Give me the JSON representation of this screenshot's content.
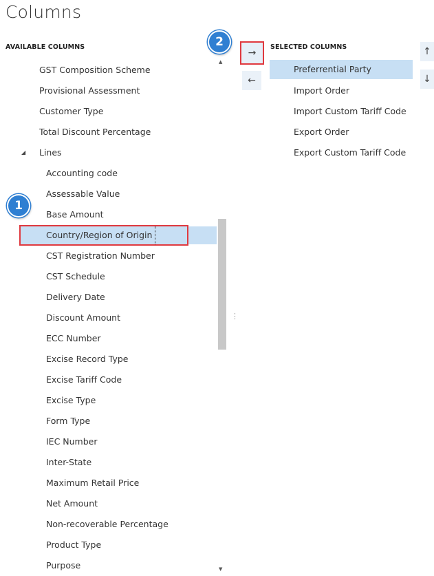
{
  "page": {
    "title": "Columns"
  },
  "available": {
    "header": "AVAILABLE COLUMNS",
    "items": [
      {
        "label": "GST Composition Scheme"
      },
      {
        "label": "Provisional Assessment"
      },
      {
        "label": "Customer Type"
      },
      {
        "label": "Total Discount Percentage"
      },
      {
        "label": "Lines",
        "group": true,
        "expanded": true
      },
      {
        "label": "Accounting code"
      },
      {
        "label": "Assessable Value"
      },
      {
        "label": "Base Amount"
      },
      {
        "label": "Country/Region of Origin",
        "selected": true
      },
      {
        "label": "CST Registration Number"
      },
      {
        "label": "CST Schedule"
      },
      {
        "label": "Delivery Date"
      },
      {
        "label": "Discount Amount"
      },
      {
        "label": "ECC Number"
      },
      {
        "label": "Excise Record Type"
      },
      {
        "label": "Excise Tariff Code"
      },
      {
        "label": "Excise Type"
      },
      {
        "label": "Form Type"
      },
      {
        "label": "IEC Number"
      },
      {
        "label": "Inter-State"
      },
      {
        "label": "Maximum Retail Price"
      },
      {
        "label": "Net Amount"
      },
      {
        "label": "Non-recoverable Percentage"
      },
      {
        "label": "Product Type"
      },
      {
        "label": "Purpose"
      }
    ]
  },
  "selected": {
    "header": "SELECTED COLUMNS",
    "items": [
      {
        "label": "Preferrential Party",
        "selected": true
      },
      {
        "label": "Import Order"
      },
      {
        "label": "Import Custom Tariff Code"
      },
      {
        "label": "Export Order"
      },
      {
        "label": "Export Custom Tariff Code"
      }
    ]
  },
  "buttons": {
    "add": "→",
    "remove": "←",
    "move_up": "↑",
    "move_down": "↓"
  },
  "badges": {
    "one": "1",
    "two": "2"
  },
  "glyphs": {
    "scroll_up": "▲",
    "scroll_down": "▼",
    "group_expander": "◢",
    "splitter": "⋮"
  },
  "colors": {
    "selection": "#c7dff4",
    "callout_box": "#e0393f",
    "badge": "#2f7fd2",
    "button_bg": "#eaf1f8"
  }
}
